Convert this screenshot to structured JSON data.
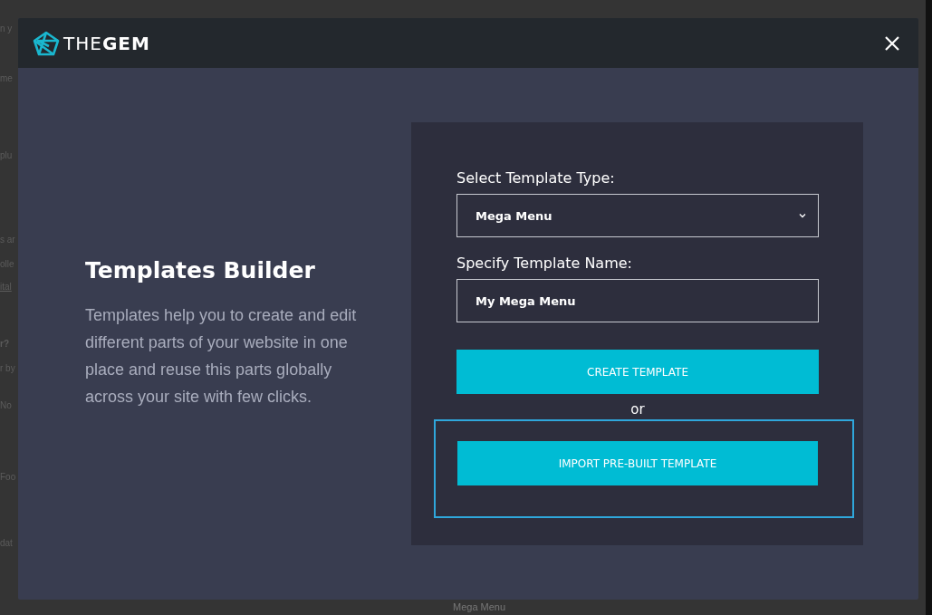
{
  "backdrop": {
    "texts": [
      "n y",
      "me",
      "plu",
      "s ar",
      "olle",
      "ital",
      "r?",
      "r by",
      "No",
      "Foo",
      "dat"
    ],
    "bottom_text": "Mega Menu"
  },
  "modal": {
    "logo": "THE**GEM**",
    "title": "Templates Builder",
    "description": "Templates help you to create and edit different parts of your website in one place and reuse this parts globally across your site with few clicks.",
    "form": {
      "type_label": "Select Template Type:",
      "type_value": "Mega Menu",
      "name_label": "Specify Template Name:",
      "name_value": "My Mega Menu",
      "create_button": "CREATE TEMPLATE",
      "separator": "or",
      "import_button": "IMPORT PRE-BUILT TEMPLATE",
      "import_highlighted": true
    }
  }
}
